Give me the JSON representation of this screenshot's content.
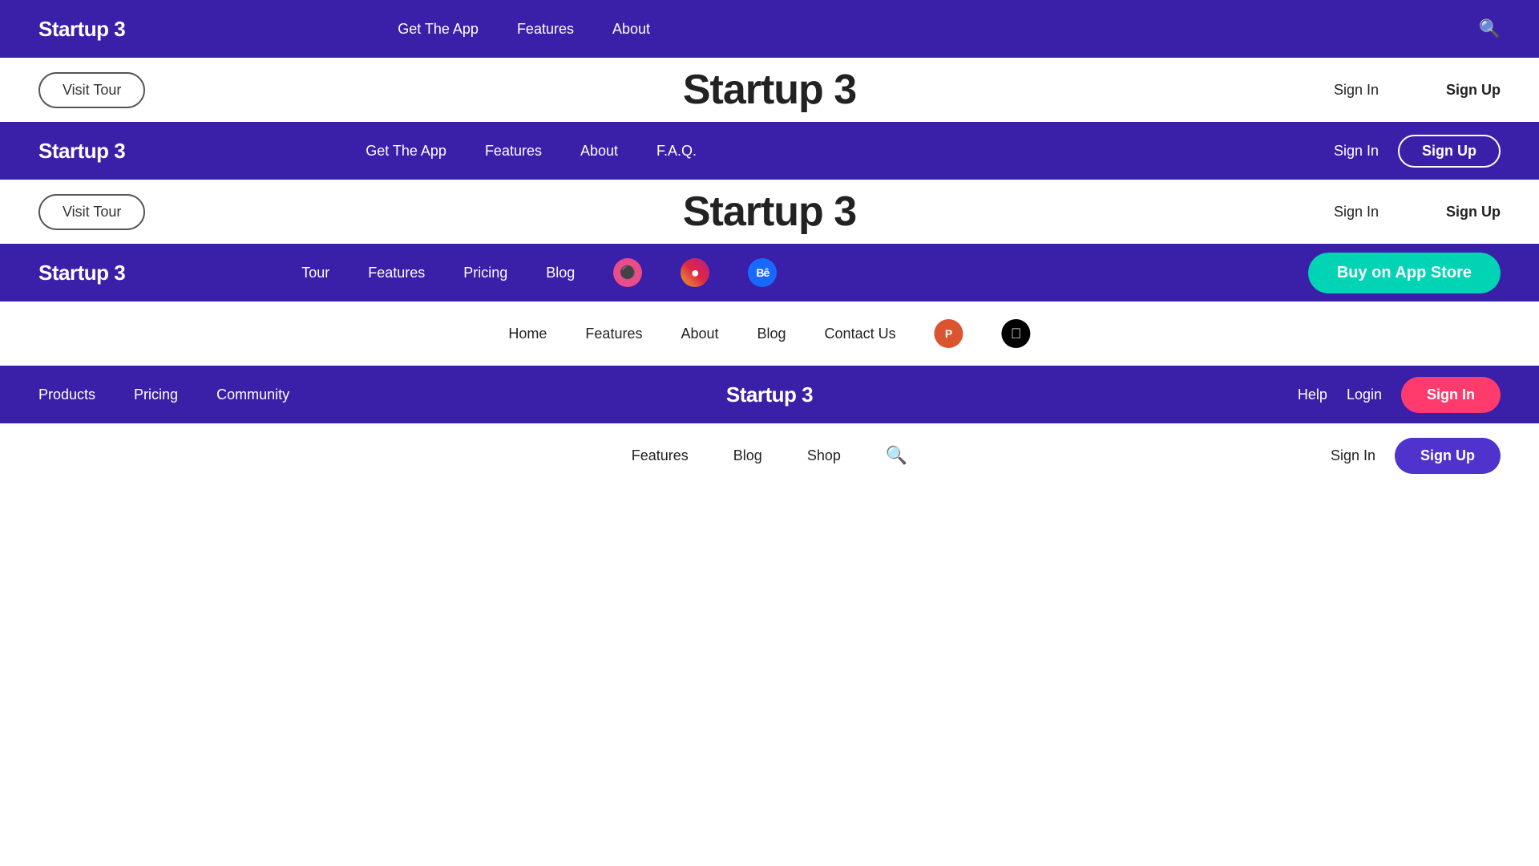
{
  "navbars": [
    {
      "id": "bar1",
      "type": "dark",
      "logo": "Startup 3",
      "links": [
        "Get The App",
        "Features",
        "About"
      ],
      "right": {
        "hasSearch": true
      }
    },
    {
      "id": "bar2",
      "type": "light",
      "logo": "Startup 3",
      "links": [],
      "right": {
        "signIn": "Sign In",
        "signUp": "Sign Up"
      }
    },
    {
      "id": "bar3",
      "type": "dark",
      "logo": "Startup 3",
      "links": [
        "Get The App",
        "Features",
        "About",
        "F.A.Q."
      ],
      "right": {
        "signIn": "Sign In",
        "signUp": "Sign Up",
        "signUpOutline": true
      }
    },
    {
      "id": "bar4",
      "type": "light",
      "logo": "Startup 3",
      "links": [],
      "right": {
        "signIn": "Sign In",
        "signUp": "Sign Up"
      }
    },
    {
      "id": "bar5",
      "type": "dark",
      "logo": "Startup 3",
      "links": [
        "Tour",
        "Features",
        "Pricing",
        "Blog"
      ],
      "socials": [
        "dribbble",
        "instagram",
        "behance"
      ],
      "right": {
        "buyAppStore": "Buy on App Store"
      }
    },
    {
      "id": "bar6",
      "type": "light",
      "logo": "",
      "links": [
        "Home",
        "Features",
        "About",
        "Blog",
        "Contact Us"
      ],
      "socials": [
        "producthunt",
        "apple"
      ],
      "right": {}
    },
    {
      "id": "bar7",
      "type": "dark",
      "logo": "Startup 3",
      "links": [
        "Products",
        "Pricing",
        "Community"
      ],
      "right": {
        "help": "Help",
        "login": "Login",
        "signIn": "Sign In",
        "signInStyle": "pink"
      }
    },
    {
      "id": "bar8",
      "type": "light",
      "logo": "",
      "links": [
        "Features",
        "Blog",
        "Shop"
      ],
      "right": {
        "signIn": "Sign In",
        "signUp": "Sign Up",
        "signUpStyle": "purple",
        "hasSearch": true
      }
    }
  ],
  "heroes": [
    {
      "id": "hero1",
      "title": "Startup 3",
      "visitTour": "Visit Tour",
      "signIn": "Sign In",
      "signUp": "Sign Up"
    },
    {
      "id": "hero2",
      "title": "Startup 3",
      "visitTour": "Visit Tour",
      "signIn": "Sign In",
      "signUp": "Sign Up"
    }
  ],
  "colors": {
    "darkBg": "#3a1fa8",
    "teal": "#00d4b4",
    "pink": "#ff3b6e",
    "purple": "#4f33cc"
  },
  "labels": {
    "getTheApp": "Get The App",
    "features": "Features",
    "about": "About",
    "faq": "F.A.Q.",
    "tour": "Tour",
    "pricing": "Pricing",
    "blog": "Blog",
    "home": "Home",
    "contactUs": "Contact Us",
    "products": "Products",
    "community": "Community",
    "shop": "Shop",
    "signIn": "Sign In",
    "signUp": "Sign Up",
    "visitTour": "Visit Tour",
    "startup3": "Startup 3",
    "buyOnAppStore": "Buy on App Store",
    "help": "Help",
    "login": "Login"
  }
}
